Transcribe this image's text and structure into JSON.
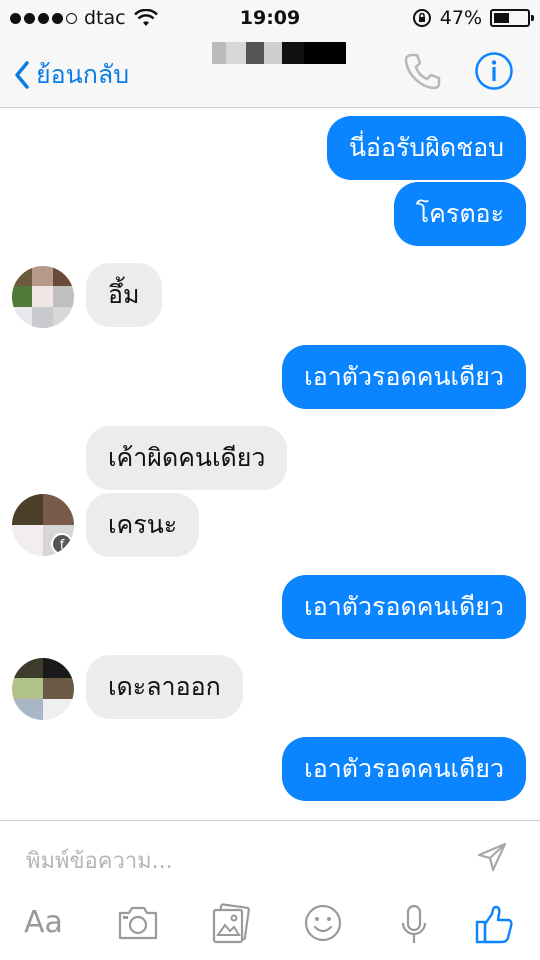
{
  "status_bar": {
    "carrier": "dtac",
    "time": "19:09",
    "battery_text": "47%",
    "battery_level": 0.47,
    "signal_bars_filled": 4
  },
  "nav": {
    "back_label": "ย้อนกลับ",
    "title_redacted": true,
    "call_icon": "phone-icon",
    "info_icon": "info-icon"
  },
  "messages": [
    {
      "side": "out",
      "text": "นี่อ่อรับผิดชอบ"
    },
    {
      "side": "out",
      "text": "โครตอะ"
    },
    {
      "side": "in",
      "text": "อึ้ม"
    },
    {
      "side": "out",
      "text": "เอาตัวรอดคนเดียว"
    },
    {
      "side": "in",
      "text": "เค้าผิดคนเดียว"
    },
    {
      "side": "in",
      "text": "เครนะ"
    },
    {
      "side": "out",
      "text": "เอาตัวรอดคนเดียว"
    },
    {
      "side": "in",
      "text": "เดะลาออก"
    },
    {
      "side": "out",
      "text": "เอาตัวรอดคนเดียว"
    }
  ],
  "composer": {
    "placeholder": "พิมพ์ข้อความ...",
    "value": "",
    "aa_label": "Aa",
    "tools": [
      "text-format-icon",
      "camera-icon",
      "photo-gallery-icon",
      "emoji-icon",
      "microphone-icon",
      "like-icon"
    ]
  },
  "colors": {
    "accent": "#0a84ff",
    "incoming_bubble": "#ececec",
    "bar_background": "#f7f7f7"
  }
}
